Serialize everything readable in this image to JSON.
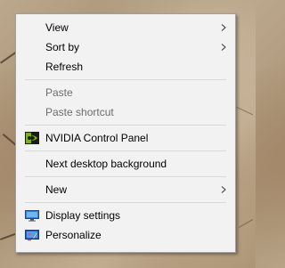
{
  "context_menu": {
    "items": [
      {
        "label": "View",
        "submenu": true,
        "disabled": false
      },
      {
        "label": "Sort by",
        "submenu": true,
        "disabled": false
      },
      {
        "label": "Refresh",
        "submenu": false,
        "disabled": false
      },
      {
        "label": "Paste",
        "submenu": false,
        "disabled": true
      },
      {
        "label": "Paste shortcut",
        "submenu": false,
        "disabled": true
      },
      {
        "label": "NVIDIA Control Panel",
        "icon": "nvidia-icon",
        "submenu": false,
        "disabled": false
      },
      {
        "label": "Next desktop background",
        "submenu": false,
        "disabled": false
      },
      {
        "label": "New",
        "submenu": true,
        "disabled": false
      },
      {
        "label": "Display settings",
        "icon": "display-settings-icon",
        "submenu": false,
        "disabled": false
      },
      {
        "label": "Personalize",
        "icon": "personalize-icon",
        "submenu": false,
        "disabled": false
      }
    ]
  },
  "icons": {
    "submenu_arrow": "chevron-right-icon",
    "nvidia": "nvidia-icon",
    "display": "display-settings-icon",
    "personalize": "personalize-icon"
  },
  "colors": {
    "menu_background": "#f2f2f2",
    "menu_border": "#a0a0a0",
    "separator": "#d7d7d7",
    "text": "#000000",
    "disabled_text": "#6d6d6d",
    "nvidia_green": "#76b900"
  }
}
